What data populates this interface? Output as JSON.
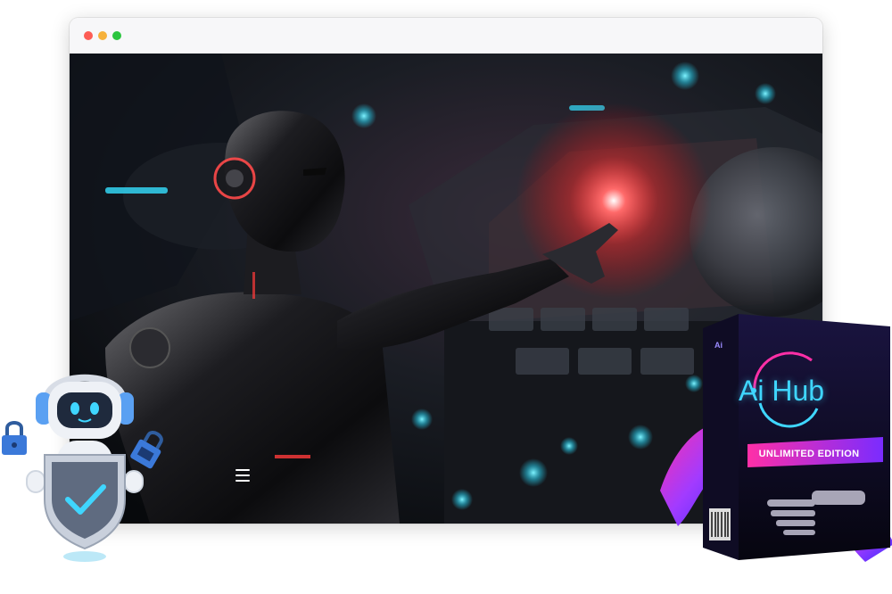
{
  "browser": {
    "controls": [
      "close",
      "minimize",
      "maximize"
    ],
    "control_colors": {
      "close": "#fd5c55",
      "minimize": "#f6b13b",
      "maximize": "#2bc53f"
    }
  },
  "hero": {
    "menu_icon": "hamburger-menu-icon"
  },
  "product_box": {
    "brand_mark": "Ai",
    "title": "Ai Hub",
    "edition": "UNLIMITED EDITION"
  },
  "mascot": {
    "icons": [
      "padlock-icon",
      "checkmark-shield-icon",
      "headphones-icon"
    ]
  },
  "colors": {
    "accent_cyan": "#35e0ff",
    "accent_red": "#ff3b3b",
    "accent_purple": "#8a2be2",
    "accent_pink": "#ff2fa7"
  }
}
